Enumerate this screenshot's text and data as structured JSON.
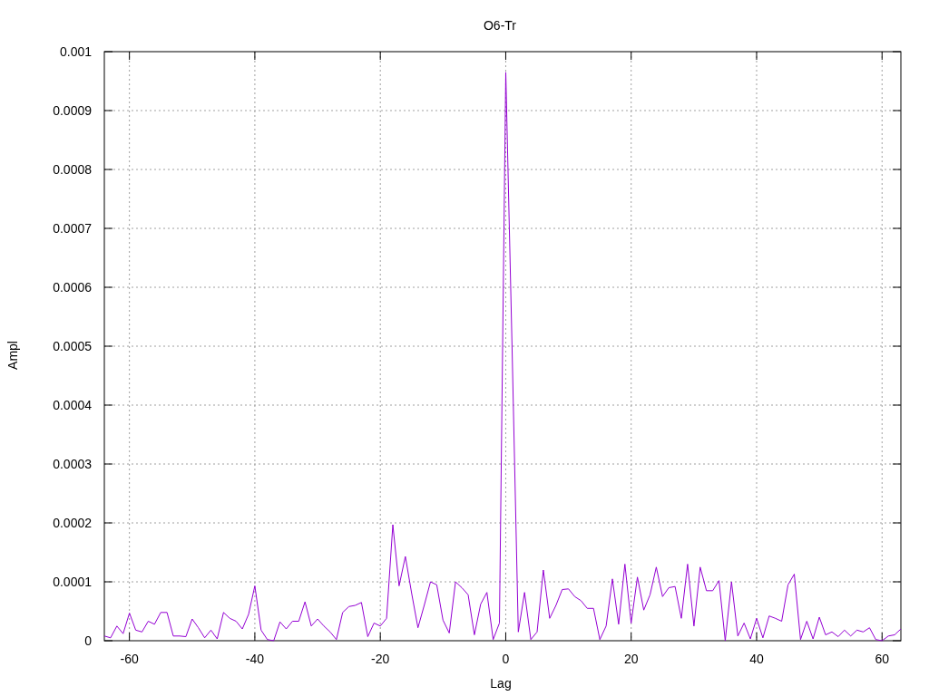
{
  "chart_data": {
    "type": "line",
    "title": "O6-Tr",
    "xlabel": "Lag",
    "ylabel": "Ampl",
    "x": [
      -64,
      -63,
      -62,
      -61,
      -60,
      -59,
      -58,
      -57,
      -56,
      -55,
      -54,
      -53,
      -52,
      -51,
      -50,
      -49,
      -48,
      -47,
      -46,
      -45,
      -44,
      -43,
      -42,
      -41,
      -40,
      -39,
      -38,
      -37,
      -36,
      -35,
      -34,
      -33,
      -32,
      -31,
      -30,
      -29,
      -28,
      -27,
      -26,
      -25,
      -24,
      -23,
      -22,
      -21,
      -20,
      -19,
      -18,
      -17,
      -16,
      -15,
      -14,
      -13,
      -12,
      -11,
      -10,
      -9,
      -8,
      -7,
      -6,
      -5,
      -4,
      -3,
      -2,
      -1,
      0,
      1,
      2,
      3,
      4,
      5,
      6,
      7,
      8,
      9,
      10,
      11,
      12,
      13,
      14,
      15,
      16,
      17,
      18,
      19,
      20,
      21,
      22,
      23,
      24,
      25,
      26,
      27,
      28,
      29,
      30,
      31,
      32,
      33,
      34,
      35,
      36,
      37,
      38,
      39,
      40,
      41,
      42,
      43,
      44,
      45,
      46,
      47,
      48,
      49,
      50,
      51,
      52,
      53,
      54,
      55,
      56,
      57,
      58,
      59,
      60,
      61,
      62,
      63
    ],
    "series": [
      {
        "color": "#9400d3",
        "values": [
          8e-06,
          5e-06,
          2.5e-05,
          1.2e-05,
          4.7e-05,
          1.8e-05,
          1.5e-05,
          3.3e-05,
          2.8e-05,
          4.8e-05,
          4.8e-05,
          8e-06,
          8e-06,
          7e-06,
          3.7e-05,
          2.2e-05,
          5e-06,
          1.8e-05,
          3e-06,
          4.8e-05,
          3.8e-05,
          3.3e-05,
          2e-05,
          4.5e-05,
          9.3e-05,
          1.8e-05,
          2e-06,
          0,
          3.2e-05,
          2e-05,
          3.3e-05,
          3.3e-05,
          6.6e-05,
          2.5e-05,
          3.7e-05,
          2.5e-05,
          1.5e-05,
          2e-06,
          4.8e-05,
          5.8e-05,
          6e-05,
          6.5e-05,
          7e-06,
          3e-05,
          2.5e-05,
          3.8e-05,
          0.000197,
          9.3e-05,
          0.000143,
          8e-05,
          2.2e-05,
          6e-05,
          0.0001,
          9.5e-05,
          3.5e-05,
          1.3e-05,
          0.0001,
          9e-05,
          7.8e-05,
          1e-05,
          6.2e-05,
          8.2e-05,
          2e-06,
          3e-05,
          0.000965,
          0.0005,
          1.5e-05,
          8.2e-05,
          2e-06,
          1.5e-05,
          0.00012,
          3.8e-05,
          6e-05,
          8.7e-05,
          8.8e-05,
          7.5e-05,
          6.8e-05,
          5.5e-05,
          5.5e-05,
          2e-06,
          2.5e-05,
          0.000105,
          2.8e-05,
          0.00013,
          3e-05,
          0.000108,
          5.2e-05,
          7.8e-05,
          0.000125,
          7.5e-05,
          9e-05,
          9.2e-05,
          3.8e-05,
          0.00013,
          2.5e-05,
          0.000125,
          8.5e-05,
          8.5e-05,
          0.000102,
          0,
          0.0001,
          8e-06,
          3e-05,
          3e-06,
          3.8e-05,
          5e-06,
          4.2e-05,
          3.8e-05,
          3.3e-05,
          9.5e-05,
          0.000113,
          2e-06,
          3.3e-05,
          3e-06,
          4e-05,
          1e-05,
          1.5e-05,
          7e-06,
          1.8e-05,
          8e-06,
          1.8e-05,
          1.5e-05,
          2.2e-05,
          2e-06,
          0,
          8e-06,
          1e-05,
          2e-05
        ]
      }
    ],
    "xlim": [
      -64,
      63
    ],
    "ylim": [
      0,
      0.001
    ],
    "grid": true,
    "xticks": [
      -60,
      -40,
      -20,
      0,
      20,
      40,
      60
    ],
    "yticks": [
      0,
      0.0001,
      0.0002,
      0.0003,
      0.0004,
      0.0005,
      0.0006,
      0.0007,
      0.0008,
      0.0009,
      0.001
    ]
  }
}
